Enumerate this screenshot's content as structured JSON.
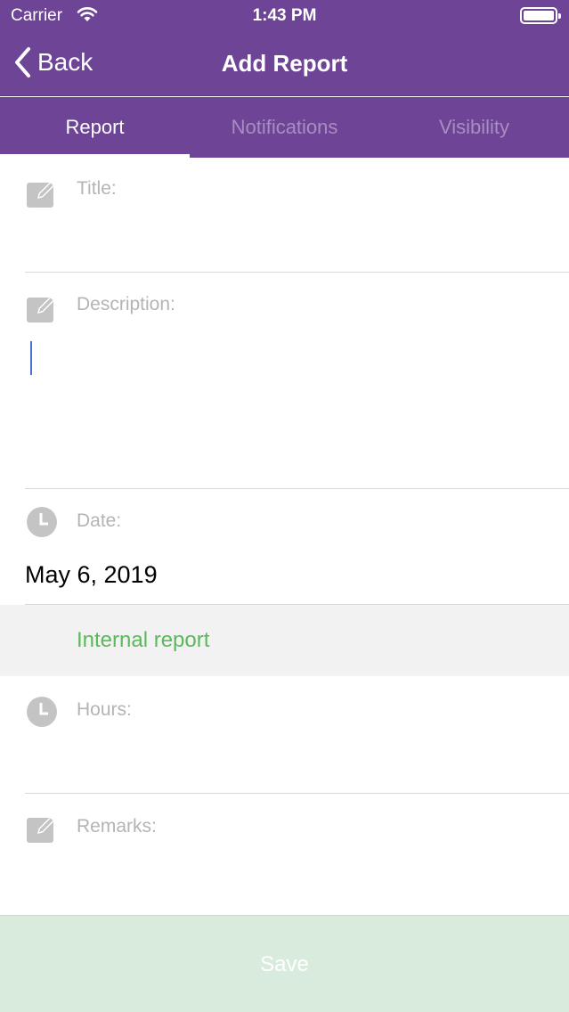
{
  "status_bar": {
    "carrier": "Carrier",
    "time": "1:43 PM",
    "icons": [
      "wifi-icon",
      "battery-icon"
    ]
  },
  "nav": {
    "back_label": "Back",
    "title": "Add Report"
  },
  "tabs": [
    {
      "label": "Report",
      "active": true
    },
    {
      "label": "Notifications",
      "active": false
    },
    {
      "label": "Visibility",
      "active": false
    }
  ],
  "form": {
    "title": {
      "label": "Title:",
      "icon": "edit-icon",
      "value": ""
    },
    "description": {
      "label": "Description:",
      "icon": "edit-icon",
      "value": ""
    },
    "date": {
      "label": "Date:",
      "icon": "clock-icon",
      "value": "May 6, 2019"
    },
    "internal_report": {
      "label": "Internal report"
    },
    "hours": {
      "label": "Hours:",
      "icon": "clock-icon",
      "value": ""
    },
    "remarks": {
      "label": "Remarks:",
      "icon": "edit-icon",
      "value": ""
    }
  },
  "save_label": "Save",
  "colors": {
    "brand": "#6e4596",
    "accent_green": "#5cb85c",
    "save_bg": "#d8ebdc",
    "label_gray": "#b4b4b4"
  }
}
